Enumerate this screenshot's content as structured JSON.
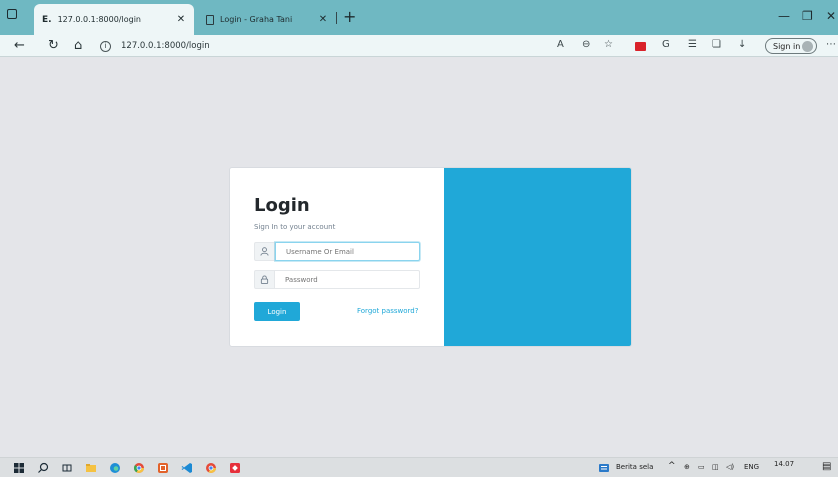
{
  "browser": {
    "tabs": [
      {
        "favicon": "E.",
        "title": "127.0.0.1:8000/login",
        "active": true
      },
      {
        "favicon": "page-icon",
        "title": "Login - Graha Tani",
        "active": false
      }
    ],
    "url": "127.0.0.1:8000/login",
    "sign_in_label": "Sign in"
  },
  "login": {
    "title": "Login",
    "subtitle": "Sign In to your account",
    "username_placeholder": "Username Or Email",
    "password_placeholder": "Password",
    "login_button": "Login",
    "forgot_link": "Forgot password?"
  },
  "taskbar": {
    "news": "Berita sela",
    "lang": "ENG",
    "time": "14.07"
  },
  "colors": {
    "accent": "#20a8d8",
    "titlebar": "#6fb8c2",
    "page_bg": "#e4e5e9"
  }
}
